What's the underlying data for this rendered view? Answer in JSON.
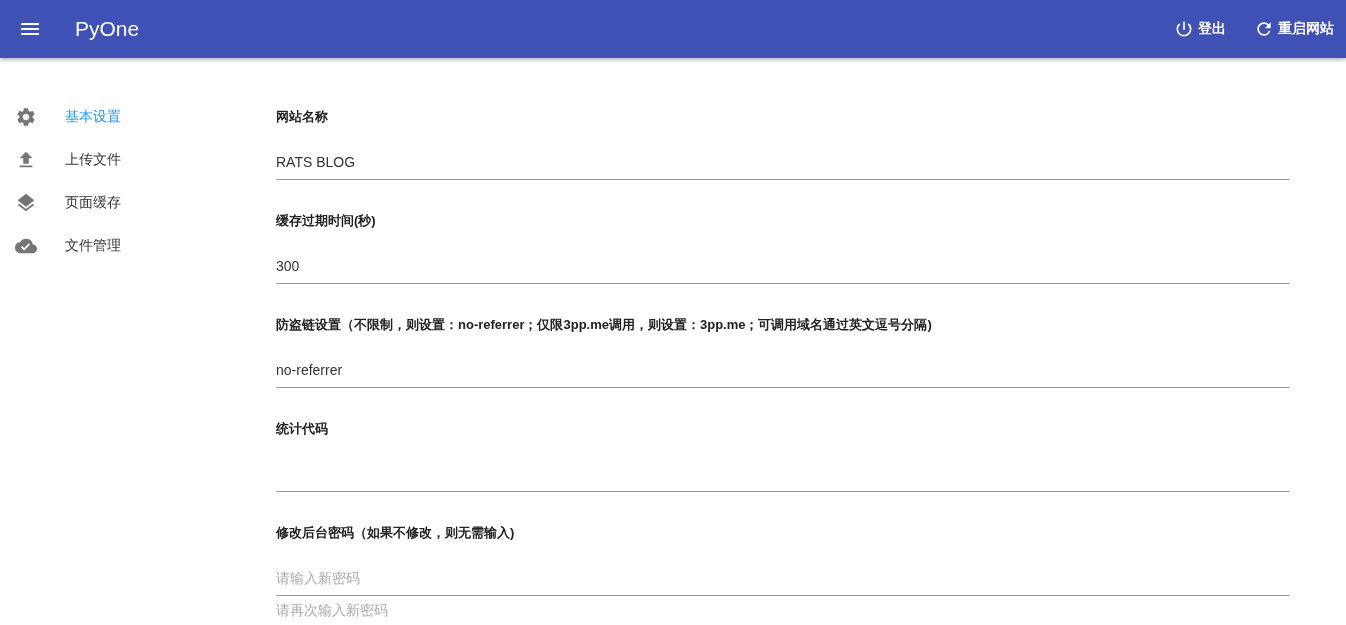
{
  "app_bar": {
    "title": "PyOne",
    "actions": [
      {
        "kind": "logout",
        "label": "登出"
      },
      {
        "kind": "restart",
        "label": "重启网站"
      }
    ]
  },
  "sidebar": {
    "items": [
      {
        "kind": "settings",
        "label": "基本设置",
        "selected": true
      },
      {
        "kind": "upload",
        "label": "上传文件",
        "selected": false
      },
      {
        "kind": "cache",
        "label": "页面缓存",
        "selected": false
      },
      {
        "kind": "files",
        "label": "文件管理",
        "selected": false
      }
    ]
  },
  "form": {
    "sections": [
      {
        "label": "网站名称",
        "inputs": [
          {
            "kind": "line",
            "value": "RATS BLOG"
          }
        ]
      },
      {
        "label": "缓存过期时间(秒)",
        "inputs": [
          {
            "kind": "line",
            "value": "300"
          }
        ]
      },
      {
        "label": "防盗链设置（不限制，则设置：no-referrer；仅限3pp.me调用，则设置：3pp.me；可调用域名通过英文逗号分隔)",
        "inputs": [
          {
            "kind": "line",
            "value": "no-referrer"
          }
        ]
      },
      {
        "label": "统计代码",
        "inputs": [
          {
            "kind": "line"
          }
        ]
      },
      {
        "label": "修改后台密码（如果不修改，则无需输入)",
        "inputs": [
          {
            "kind": "line",
            "placeholder": "请输入新密码"
          },
          {
            "kind": "line",
            "placeholder": "请再次输入新密码"
          }
        ]
      }
    ]
  }
}
